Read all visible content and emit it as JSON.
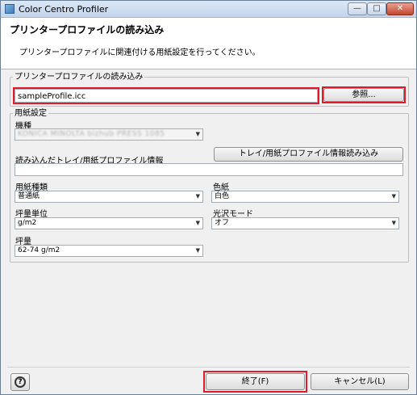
{
  "window": {
    "title": "Color Centro Profiler",
    "controls": {
      "minimize": "—",
      "maximize": "□",
      "close": "✕"
    }
  },
  "header": {
    "title": "プリンタープロファイルの読み込み",
    "description": "プリンタープロファイルに関連付ける用紙設定を行ってください。"
  },
  "profile_group": {
    "label": "プリンタープロファイルの読み込み",
    "file_value": "sampleProfile.icc",
    "browse_label": "参照..."
  },
  "paper_group": {
    "label": "用紙設定",
    "model_label": "機種",
    "model_value": "KONICA MINOLTA bizhub PRESS 1085",
    "tray_info_label": "読み込んだトレイ/用紙プロファイル情報",
    "tray_button_label": "トレイ/用紙プロファイル情報読み込み",
    "tray_info_value": "",
    "paper_type_label": "用紙種類",
    "paper_type_value": "普通紙",
    "color_label": "色紙",
    "color_value": "白色",
    "weight_unit_label": "坪量単位",
    "weight_unit_value": "g/m2",
    "gloss_label": "光沢モード",
    "gloss_value": "オフ",
    "weight_label": "坪量",
    "weight_value": "62-74 g/m2"
  },
  "footer": {
    "help_label": "?",
    "finish_label": "終了(F)",
    "cancel_label": "キャンセル(L)"
  },
  "icons": {
    "dropdown": "▼"
  }
}
